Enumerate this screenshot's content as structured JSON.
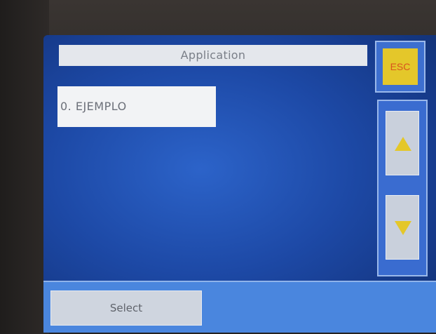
{
  "header": {
    "title": "Application"
  },
  "esc": {
    "label": "ESC"
  },
  "list": {
    "items": [
      {
        "label": "0. EJEMPLO"
      }
    ]
  },
  "scroll": {
    "up_icon": "triangle-up-icon",
    "down_icon": "triangle-down-icon"
  },
  "footer": {
    "select_label": "Select"
  },
  "colors": {
    "screen_blue": "#1d49a6",
    "accent_yellow": "#e4c72a",
    "esc_text": "#d9541e",
    "button_gray": "#cfd5df"
  }
}
